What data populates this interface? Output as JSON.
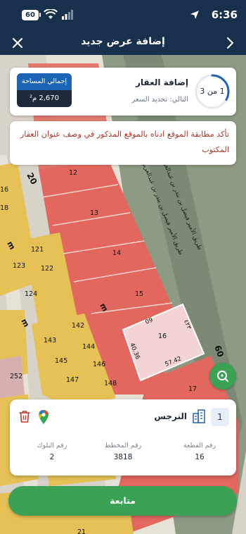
{
  "status_bar": {
    "time": "6:36",
    "battery": "60"
  },
  "header": {
    "title": "إضافة عرض جديد"
  },
  "step": {
    "counter": "1 من 3",
    "title": "إضافة العقار",
    "next": "التالي: تحديد السعر",
    "progress_fraction": 0.333
  },
  "area": {
    "label": "إجمالي المساحة",
    "value": "2,670 م²"
  },
  "warning": {
    "text": "تأكد مطابقة الموقع ادناه بالموقع المذكور في وصف عنوان العقار المكتوب"
  },
  "map": {
    "road_label_1": "طريق الأمير فيصل بن بندر بن عبدالعزيز",
    "road_label_2": "طريق الأمير فيصل بن بندر بن عبدالعزيز",
    "street_20": "20",
    "street_60": "60",
    "street_m": "m",
    "parcel_numbers": [
      "12",
      "13",
      "14",
      "15",
      "16",
      "17",
      "121",
      "122",
      "123",
      "124",
      "142",
      "143",
      "144",
      "145",
      "146",
      "147",
      "148",
      "252",
      "16",
      "18",
      "21"
    ],
    "dimensions": [
      "09",
      "٤٢٣",
      "57.42",
      "40.36"
    ],
    "colors": {
      "residential": "#e6c155",
      "commercial": "#e2685f",
      "selected": "#f3d3d3",
      "road": "#8d9a84"
    }
  },
  "parcel": {
    "badge": "1",
    "neighborhood": "النرجس",
    "fields": [
      {
        "label": "رقم القطعة",
        "value": "16"
      },
      {
        "label": "رقم المخطط",
        "value": "3818"
      },
      {
        "label": "رقم البلوك",
        "value": "2"
      }
    ]
  },
  "buttons": {
    "continue": "متابعة"
  },
  "icons": {
    "close": "close-icon",
    "back": "chevron-right-icon",
    "locate": "search-location-icon",
    "building": "building-icon",
    "maps": "google-maps-icon",
    "trash": "trash-icon"
  }
}
